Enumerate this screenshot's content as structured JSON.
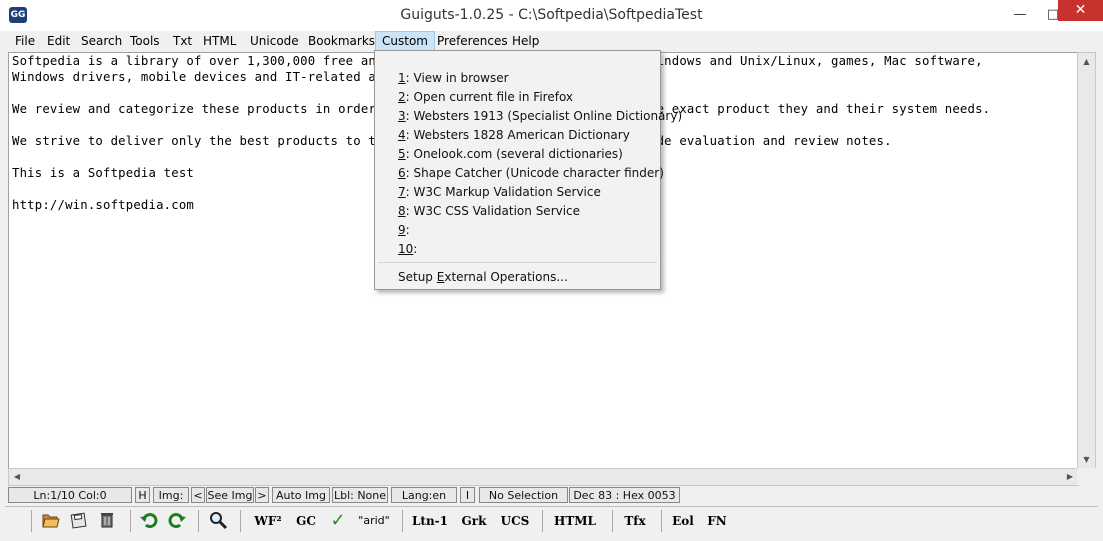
{
  "window": {
    "title": "Guiguts-1.0.25 - C:\\Softpedia\\SoftpediaTest",
    "icon_label": "GG",
    "minimize_glyph": "—",
    "maximize_glyph": "□",
    "close_glyph": "✕"
  },
  "menubar": {
    "items": [
      {
        "label": "File"
      },
      {
        "label": "Edit"
      },
      {
        "label": "Search"
      },
      {
        "label": "Tools"
      },
      {
        "label": "Txt"
      },
      {
        "label": "HTML"
      },
      {
        "label": "Unicode"
      },
      {
        "label": "Bookmarks"
      },
      {
        "label": "Custom"
      },
      {
        "label": "Preferences"
      },
      {
        "label": "Help"
      }
    ],
    "active": "Custom"
  },
  "editor": {
    "lines": [
      "Softpedia is a library of over 1,300,000 free and free-to-try software programs for Windows and Unix/Linux, games, Mac software,",
      "Windows drivers, mobile devices and IT-related articles.",
      "",
      "We review and categorize these products in order to allow the visitor/user to find the exact product they and their system needs.",
      "",
      "We strive to deliver only the best products to the visitor/user together with self-made evaluation and review notes.",
      "",
      "This is a Softpedia test",
      "",
      "http://win.softpedia.com"
    ]
  },
  "custom_menu": {
    "items": [
      {
        "key": "1",
        "rest": ": View in browser"
      },
      {
        "key": "2",
        "rest": ": Open current file in Firefox"
      },
      {
        "key": "3",
        "rest": ": Websters 1913 (Specialist Online Dictionary)"
      },
      {
        "key": "4",
        "rest": ": Websters 1828 American Dictionary"
      },
      {
        "key": "5",
        "rest": ": Onelook.com (several dictionaries)"
      },
      {
        "key": "6",
        "rest": ": Shape Catcher (Unicode character finder)"
      },
      {
        "key": "7",
        "rest": ": W3C Markup Validation Service"
      },
      {
        "key": "8",
        "rest": ": W3C CSS Validation Service"
      },
      {
        "key": "9",
        "rest": ":"
      },
      {
        "key": "10",
        "rest": ":"
      }
    ],
    "setup": {
      "pre": "Setup ",
      "key": "E",
      "post": "xternal Operations..."
    }
  },
  "statusbar": {
    "line_col": "Ln:1/10 Col:0",
    "h": "H",
    "img": "Img:",
    "prev": "<",
    "see_img": "See Img",
    "next": ">",
    "auto_img": "Auto Img",
    "lbl": "Lbl: None",
    "lang": "Lang:en",
    "i": "I",
    "selection": "No Selection",
    "char_code": "Dec 83 : Hex 0053"
  },
  "toolbar": {
    "wf2": "WF²",
    "gc": "GC",
    "checkmark": "✓",
    "arid": "\"arid\"",
    "ltn1": "Ltn-1",
    "grk": "Grk",
    "ucs": "UCS",
    "html": "HTML",
    "tfx": "Tfx",
    "eol": "Eol",
    "fn": "FN"
  },
  "colors": {
    "close_button": "#c7312e",
    "active_menu_bg": "#cce4f7",
    "check_green": "#1f8f1f"
  },
  "icons": [
    "open-folder-icon",
    "save-icon",
    "trash-icon",
    "undo-icon",
    "redo-icon",
    "search-magnifier-icon",
    "check-icon"
  ]
}
